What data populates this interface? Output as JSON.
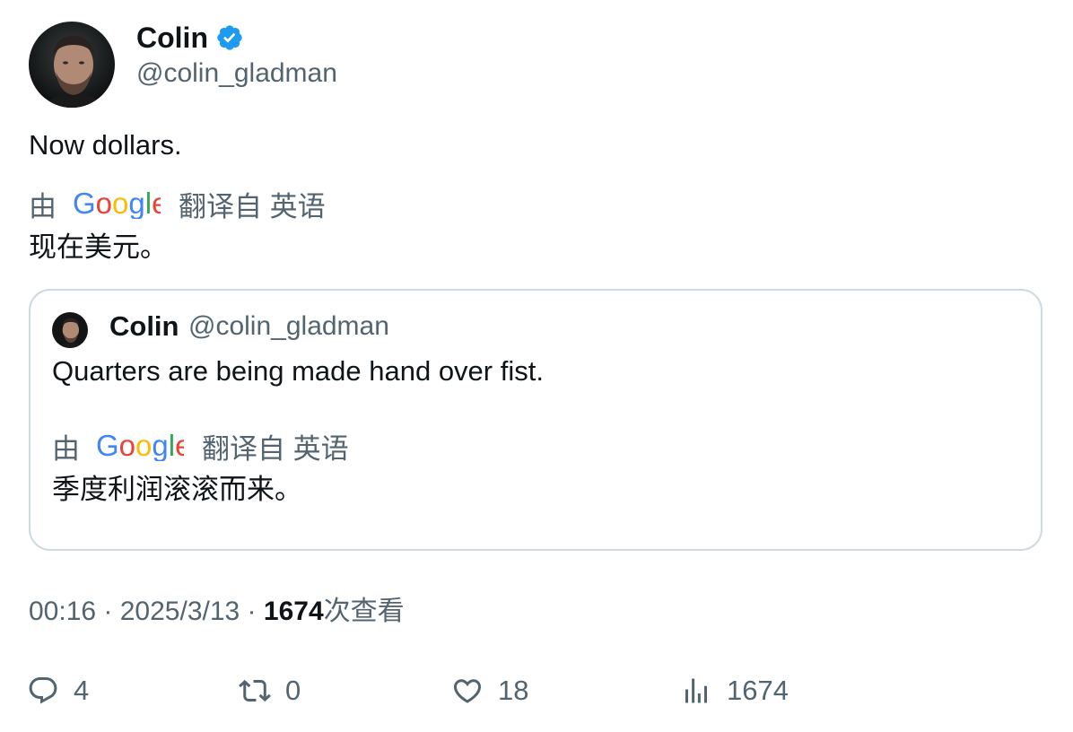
{
  "author": {
    "name": "Colin",
    "handle": "@colin_gladman",
    "verified": true,
    "verified_color": "#1d9bf0"
  },
  "tweet": {
    "text": "Now dollars.",
    "translation": {
      "prefix": "由",
      "provider": "Google",
      "suffix": "翻译自 英语",
      "text": "现在美元。"
    }
  },
  "quote": {
    "name": "Colin",
    "handle": "@colin_gladman",
    "text": "Quarters are being made hand over fist.",
    "translation": {
      "prefix": "由",
      "provider": "Google",
      "suffix": "翻译自 英语",
      "text": "季度利润滚滚而来。"
    }
  },
  "meta": {
    "time": "00:16",
    "separator": " · ",
    "date": "2025/3/13",
    "views_count": "1674",
    "views_label": "次查看"
  },
  "actions": {
    "replies": "4",
    "reposts": "0",
    "likes": "18",
    "views": "1674"
  },
  "colors": {
    "text_primary": "#0f1419",
    "text_secondary": "#536471",
    "border": "#cfd9de",
    "google_blue": "#4285F4",
    "google_red": "#EA4335",
    "google_yellow": "#FBBC05",
    "google_green": "#34A853"
  }
}
